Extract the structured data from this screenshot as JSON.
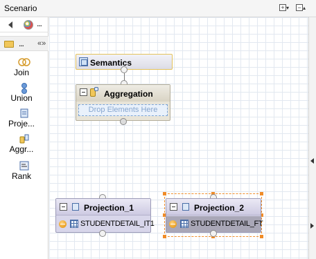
{
  "header": {
    "title": "Scenario",
    "btn_expand": "+",
    "btn_collapse": "−"
  },
  "palette": {
    "more_top": "...",
    "more_row2": "...",
    "tools": [
      {
        "label": "Join",
        "icon": "join-icon"
      },
      {
        "label": "Union",
        "icon": "union-icon"
      },
      {
        "label": "Proje...",
        "icon": "projection-icon"
      },
      {
        "label": "Aggr...",
        "icon": "aggregation-icon"
      },
      {
        "label": "Rank",
        "icon": "rank-icon"
      }
    ]
  },
  "canvas": {
    "semantics": {
      "title": "Semantics"
    },
    "aggregation": {
      "title": "Aggregation",
      "drop_hint": "Drop Elements Here"
    },
    "projection_1": {
      "title": "Projection_1",
      "table": "STUDENTDETAIL_IT1"
    },
    "projection_2": {
      "title": "Projection_2",
      "table": "STUDENTDETAIL_FT",
      "selected": true
    }
  },
  "colors": {
    "semantics_border": "#e4c25a",
    "selection": "#f08c28",
    "drop_zone": "#7aa4d8"
  }
}
